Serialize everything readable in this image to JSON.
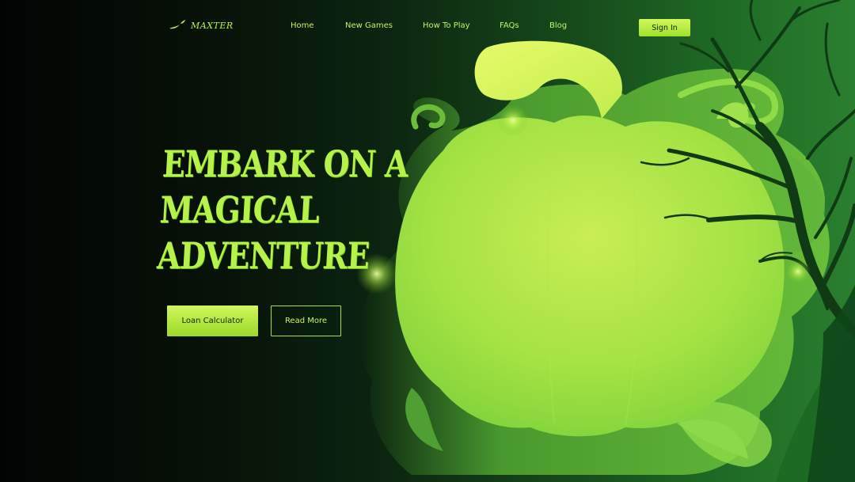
{
  "brand": {
    "name": "MAXTER",
    "accent_color": "#b6f24a"
  },
  "nav": {
    "items": [
      {
        "label": "Home"
      },
      {
        "label": "New Games"
      },
      {
        "label": "How To Play"
      },
      {
        "label": "FAQs"
      },
      {
        "label": "Blog"
      }
    ],
    "signin_label": "Sign In"
  },
  "hero": {
    "title_lines": [
      "EMBARK ON A",
      "MAGICAL",
      "ADVENTURE"
    ],
    "primary_button": "Loan Calculator",
    "secondary_button": "Read More"
  },
  "illustration": {
    "subject": "glowing pumpkin with stem",
    "elements": [
      "pumpkin-icon",
      "swirl-smoke",
      "dead-tree",
      "glow-orb"
    ]
  }
}
